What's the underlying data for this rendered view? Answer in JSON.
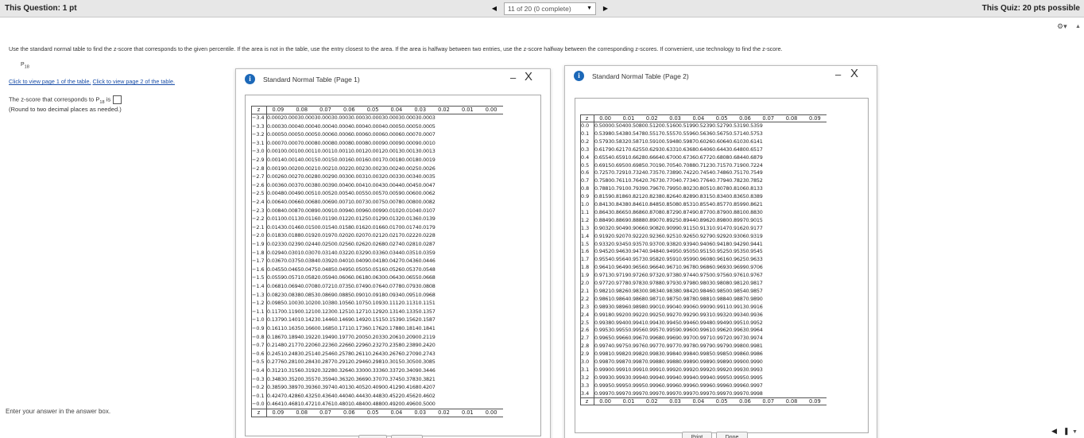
{
  "header": {
    "question_label": "This Question: 1 pt",
    "quiz_label": "This Quiz: 20 pts possible",
    "progress": "11 of 20 (0 complete)",
    "prev_icon": "triangle-left-icon",
    "next_icon": "triangle-right-icon",
    "dropdown_icon": "caret-down-icon"
  },
  "question": {
    "instructions": "Use the standard normal table to find the z-score that corresponds to the given percentile. If the area is not in the table, use the entry closest to the area. If the area is halfway between two entries, use the z-score halfway between the corresponding z-scores. If convenient, use technology to find the z-score.",
    "percentile_base": "P",
    "percentile_sub": "18",
    "link1": "Click to view page 1 of the table.",
    "link2": "Click to view page 2 of the table.",
    "answer_prefix": "The z-score that corresponds to P",
    "answer_sub": "18",
    "answer_suffix": " is",
    "round_note": "(Round to two decimal places as needed.)",
    "enter_message": "Enter your answer in the answer box."
  },
  "dialog1": {
    "title": "Standard Normal Table (Page 1)",
    "min_label": "–",
    "close_label": "X",
    "columns": [
      "z",
      "0.09",
      "0.08",
      "0.07",
      "0.06",
      "0.05",
      "0.04",
      "0.03",
      "0.02",
      "0.01",
      "0.00"
    ],
    "rows": [
      [
        "−3.4",
        "0.0002",
        "0.0003",
        "0.0003",
        "0.0003",
        "0.0003",
        "0.0003",
        "0.0003",
        "0.0003",
        "0.0003",
        "0.0003"
      ],
      [
        "−3.3",
        "0.0003",
        "0.0004",
        "0.0004",
        "0.0004",
        "0.0004",
        "0.0004",
        "0.0004",
        "0.0005",
        "0.0005",
        "0.0005"
      ],
      [
        "−3.2",
        "0.0005",
        "0.0005",
        "0.0005",
        "0.0006",
        "0.0006",
        "0.0006",
        "0.0006",
        "0.0006",
        "0.0007",
        "0.0007"
      ],
      [
        "−3.1",
        "0.0007",
        "0.0007",
        "0.0008",
        "0.0008",
        "0.0008",
        "0.0008",
        "0.0009",
        "0.0009",
        "0.0009",
        "0.0010"
      ],
      [
        "−3.0",
        "0.0010",
        "0.0010",
        "0.0011",
        "0.0011",
        "0.0011",
        "0.0012",
        "0.0012",
        "0.0013",
        "0.0013",
        "0.0013"
      ],
      [
        "−2.9",
        "0.0014",
        "0.0014",
        "0.0015",
        "0.0015",
        "0.0016",
        "0.0016",
        "0.0017",
        "0.0018",
        "0.0018",
        "0.0019"
      ],
      [
        "−2.8",
        "0.0019",
        "0.0020",
        "0.0021",
        "0.0021",
        "0.0022",
        "0.0023",
        "0.0023",
        "0.0024",
        "0.0025",
        "0.0026"
      ],
      [
        "−2.7",
        "0.0026",
        "0.0027",
        "0.0028",
        "0.0029",
        "0.0030",
        "0.0031",
        "0.0032",
        "0.0033",
        "0.0034",
        "0.0035"
      ],
      [
        "−2.6",
        "0.0036",
        "0.0037",
        "0.0038",
        "0.0039",
        "0.0040",
        "0.0041",
        "0.0043",
        "0.0044",
        "0.0045",
        "0.0047"
      ],
      [
        "−2.5",
        "0.0048",
        "0.0049",
        "0.0051",
        "0.0052",
        "0.0054",
        "0.0055",
        "0.0057",
        "0.0059",
        "0.0060",
        "0.0062"
      ],
      [
        "−2.4",
        "0.0064",
        "0.0066",
        "0.0068",
        "0.0069",
        "0.0071",
        "0.0073",
        "0.0075",
        "0.0078",
        "0.0080",
        "0.0082"
      ],
      [
        "−2.3",
        "0.0084",
        "0.0087",
        "0.0089",
        "0.0091",
        "0.0094",
        "0.0096",
        "0.0099",
        "0.0102",
        "0.0104",
        "0.0107"
      ],
      [
        "−2.2",
        "0.0110",
        "0.0113",
        "0.0116",
        "0.0119",
        "0.0122",
        "0.0125",
        "0.0129",
        "0.0132",
        "0.0136",
        "0.0139"
      ],
      [
        "−2.1",
        "0.0143",
        "0.0146",
        "0.0150",
        "0.0154",
        "0.0158",
        "0.0162",
        "0.0166",
        "0.0170",
        "0.0174",
        "0.0179"
      ],
      [
        "−2.0",
        "0.0183",
        "0.0188",
        "0.0192",
        "0.0197",
        "0.0202",
        "0.0207",
        "0.0212",
        "0.0217",
        "0.0222",
        "0.0228"
      ],
      [
        "−1.9",
        "0.0233",
        "0.0239",
        "0.0244",
        "0.0250",
        "0.0256",
        "0.0262",
        "0.0268",
        "0.0274",
        "0.0281",
        "0.0287"
      ],
      [
        "−1.8",
        "0.0294",
        "0.0301",
        "0.0307",
        "0.0314",
        "0.0322",
        "0.0329",
        "0.0336",
        "0.0344",
        "0.0351",
        "0.0359"
      ],
      [
        "−1.7",
        "0.0367",
        "0.0375",
        "0.0384",
        "0.0392",
        "0.0401",
        "0.0409",
        "0.0418",
        "0.0427",
        "0.0436",
        "0.0446"
      ],
      [
        "−1.6",
        "0.0455",
        "0.0465",
        "0.0475",
        "0.0485",
        "0.0495",
        "0.0505",
        "0.0516",
        "0.0526",
        "0.0537",
        "0.0548"
      ],
      [
        "−1.5",
        "0.0559",
        "0.0571",
        "0.0582",
        "0.0594",
        "0.0606",
        "0.0618",
        "0.0630",
        "0.0643",
        "0.0655",
        "0.0668"
      ],
      [
        "−1.4",
        "0.0681",
        "0.0694",
        "0.0708",
        "0.0721",
        "0.0735",
        "0.0749",
        "0.0764",
        "0.0778",
        "0.0793",
        "0.0808"
      ],
      [
        "−1.3",
        "0.0823",
        "0.0838",
        "0.0853",
        "0.0869",
        "0.0885",
        "0.0901",
        "0.0918",
        "0.0934",
        "0.0951",
        "0.0968"
      ],
      [
        "−1.2",
        "0.0985",
        "0.1003",
        "0.1020",
        "0.1038",
        "0.1056",
        "0.1075",
        "0.1093",
        "0.1112",
        "0.1131",
        "0.1151"
      ],
      [
        "−1.1",
        "0.1170",
        "0.1190",
        "0.1210",
        "0.1230",
        "0.1251",
        "0.1271",
        "0.1292",
        "0.1314",
        "0.1335",
        "0.1357"
      ],
      [
        "−1.0",
        "0.1379",
        "0.1401",
        "0.1423",
        "0.1446",
        "0.1469",
        "0.1492",
        "0.1515",
        "0.1539",
        "0.1562",
        "0.1587"
      ],
      [
        "−0.9",
        "0.1611",
        "0.1635",
        "0.1660",
        "0.1685",
        "0.1711",
        "0.1736",
        "0.1762",
        "0.1788",
        "0.1814",
        "0.1841"
      ],
      [
        "−0.8",
        "0.1867",
        "0.1894",
        "0.1922",
        "0.1949",
        "0.1977",
        "0.2005",
        "0.2033",
        "0.2061",
        "0.2090",
        "0.2119"
      ],
      [
        "−0.7",
        "0.2148",
        "0.2177",
        "0.2206",
        "0.2236",
        "0.2266",
        "0.2296",
        "0.2327",
        "0.2358",
        "0.2389",
        "0.2420"
      ],
      [
        "−0.6",
        "0.2451",
        "0.2483",
        "0.2514",
        "0.2546",
        "0.2578",
        "0.2611",
        "0.2643",
        "0.2676",
        "0.2709",
        "0.2743"
      ],
      [
        "−0.5",
        "0.2776",
        "0.2810",
        "0.2843",
        "0.2877",
        "0.2912",
        "0.2946",
        "0.2981",
        "0.3015",
        "0.3050",
        "0.3085"
      ],
      [
        "−0.4",
        "0.3121",
        "0.3156",
        "0.3192",
        "0.3228",
        "0.3264",
        "0.3300",
        "0.3336",
        "0.3372",
        "0.3409",
        "0.3446"
      ],
      [
        "−0.3",
        "0.3483",
        "0.3520",
        "0.3557",
        "0.3594",
        "0.3632",
        "0.3669",
        "0.3707",
        "0.3745",
        "0.3783",
        "0.3821"
      ],
      [
        "−0.2",
        "0.3859",
        "0.3897",
        "0.3936",
        "0.3974",
        "0.4013",
        "0.4052",
        "0.4090",
        "0.4129",
        "0.4168",
        "0.4207"
      ],
      [
        "−0.1",
        "0.4247",
        "0.4286",
        "0.4325",
        "0.4364",
        "0.4404",
        "0.4443",
        "0.4483",
        "0.4522",
        "0.4562",
        "0.4602"
      ],
      [
        "−0.0",
        "0.4641",
        "0.4681",
        "0.4721",
        "0.4761",
        "0.4801",
        "0.4840",
        "0.4880",
        "0.4920",
        "0.4960",
        "0.5000"
      ]
    ]
  },
  "dialog2": {
    "title": "Standard Normal Table (Page 2)",
    "min_label": "–",
    "close_label": "X",
    "columns": [
      "z",
      "0.00",
      "0.01",
      "0.02",
      "0.03",
      "0.04",
      "0.05",
      "0.06",
      "0.07",
      "0.08",
      "0.09"
    ],
    "rows": [
      [
        "0.0",
        "0.5000",
        "0.5040",
        "0.5080",
        "0.5120",
        "0.5160",
        "0.5199",
        "0.5239",
        "0.5279",
        "0.5319",
        "0.5359"
      ],
      [
        "0.1",
        "0.5398",
        "0.5438",
        "0.5478",
        "0.5517",
        "0.5557",
        "0.5596",
        "0.5636",
        "0.5675",
        "0.5714",
        "0.5753"
      ],
      [
        "0.2",
        "0.5793",
        "0.5832",
        "0.5871",
        "0.5910",
        "0.5948",
        "0.5987",
        "0.6026",
        "0.6064",
        "0.6103",
        "0.6141"
      ],
      [
        "0.3",
        "0.6179",
        "0.6217",
        "0.6255",
        "0.6293",
        "0.6331",
        "0.6368",
        "0.6406",
        "0.6443",
        "0.6480",
        "0.6517"
      ],
      [
        "0.4",
        "0.6554",
        "0.6591",
        "0.6628",
        "0.6664",
        "0.6700",
        "0.6736",
        "0.6772",
        "0.6808",
        "0.6844",
        "0.6879"
      ],
      [
        "0.5",
        "0.6915",
        "0.6950",
        "0.6985",
        "0.7019",
        "0.7054",
        "0.7088",
        "0.7123",
        "0.7157",
        "0.7190",
        "0.7224"
      ],
      [
        "0.6",
        "0.7257",
        "0.7291",
        "0.7324",
        "0.7357",
        "0.7389",
        "0.7422",
        "0.7454",
        "0.7486",
        "0.7517",
        "0.7549"
      ],
      [
        "0.7",
        "0.7580",
        "0.7611",
        "0.7642",
        "0.7673",
        "0.7704",
        "0.7734",
        "0.7764",
        "0.7794",
        "0.7823",
        "0.7852"
      ],
      [
        "0.8",
        "0.7881",
        "0.7910",
        "0.7939",
        "0.7967",
        "0.7995",
        "0.8023",
        "0.8051",
        "0.8078",
        "0.8106",
        "0.8133"
      ],
      [
        "0.9",
        "0.8159",
        "0.8186",
        "0.8212",
        "0.8238",
        "0.8264",
        "0.8289",
        "0.8315",
        "0.8340",
        "0.8365",
        "0.8389"
      ],
      [
        "1.0",
        "0.8413",
        "0.8438",
        "0.8461",
        "0.8485",
        "0.8508",
        "0.8531",
        "0.8554",
        "0.8577",
        "0.8599",
        "0.8621"
      ],
      [
        "1.1",
        "0.8643",
        "0.8665",
        "0.8686",
        "0.8708",
        "0.8729",
        "0.8749",
        "0.8770",
        "0.8790",
        "0.8810",
        "0.8830"
      ],
      [
        "1.2",
        "0.8849",
        "0.8869",
        "0.8888",
        "0.8907",
        "0.8925",
        "0.8944",
        "0.8962",
        "0.8980",
        "0.8997",
        "0.9015"
      ],
      [
        "1.3",
        "0.9032",
        "0.9049",
        "0.9066",
        "0.9082",
        "0.9099",
        "0.9115",
        "0.9131",
        "0.9147",
        "0.9162",
        "0.9177"
      ],
      [
        "1.4",
        "0.9192",
        "0.9207",
        "0.9222",
        "0.9236",
        "0.9251",
        "0.9265",
        "0.9279",
        "0.9292",
        "0.9306",
        "0.9319"
      ],
      [
        "1.5",
        "0.9332",
        "0.9345",
        "0.9357",
        "0.9370",
        "0.9382",
        "0.9394",
        "0.9406",
        "0.9418",
        "0.9429",
        "0.9441"
      ],
      [
        "1.6",
        "0.9452",
        "0.9463",
        "0.9474",
        "0.9484",
        "0.9495",
        "0.9505",
        "0.9515",
        "0.9525",
        "0.9535",
        "0.9545"
      ],
      [
        "1.7",
        "0.9554",
        "0.9564",
        "0.9573",
        "0.9582",
        "0.9591",
        "0.9599",
        "0.9608",
        "0.9616",
        "0.9625",
        "0.9633"
      ],
      [
        "1.8",
        "0.9641",
        "0.9649",
        "0.9656",
        "0.9664",
        "0.9671",
        "0.9678",
        "0.9686",
        "0.9693",
        "0.9699",
        "0.9706"
      ],
      [
        "1.9",
        "0.9713",
        "0.9719",
        "0.9726",
        "0.9732",
        "0.9738",
        "0.9744",
        "0.9750",
        "0.9756",
        "0.9761",
        "0.9767"
      ],
      [
        "2.0",
        "0.9772",
        "0.9778",
        "0.9783",
        "0.9788",
        "0.9793",
        "0.9798",
        "0.9803",
        "0.9808",
        "0.9812",
        "0.9817"
      ],
      [
        "2.1",
        "0.9821",
        "0.9826",
        "0.9830",
        "0.9834",
        "0.9838",
        "0.9842",
        "0.9846",
        "0.9850",
        "0.9854",
        "0.9857"
      ],
      [
        "2.2",
        "0.9861",
        "0.9864",
        "0.9868",
        "0.9871",
        "0.9875",
        "0.9878",
        "0.9881",
        "0.9884",
        "0.9887",
        "0.9890"
      ],
      [
        "2.3",
        "0.9893",
        "0.9896",
        "0.9898",
        "0.9901",
        "0.9904",
        "0.9906",
        "0.9909",
        "0.9911",
        "0.9913",
        "0.9916"
      ],
      [
        "2.4",
        "0.9918",
        "0.9920",
        "0.9922",
        "0.9925",
        "0.9927",
        "0.9929",
        "0.9931",
        "0.9932",
        "0.9934",
        "0.9936"
      ],
      [
        "2.5",
        "0.9938",
        "0.9940",
        "0.9941",
        "0.9943",
        "0.9945",
        "0.9946",
        "0.9948",
        "0.9949",
        "0.9951",
        "0.9952"
      ],
      [
        "2.6",
        "0.9953",
        "0.9955",
        "0.9956",
        "0.9957",
        "0.9959",
        "0.9960",
        "0.9961",
        "0.9962",
        "0.9963",
        "0.9964"
      ],
      [
        "2.7",
        "0.9965",
        "0.9966",
        "0.9967",
        "0.9968",
        "0.9969",
        "0.9970",
        "0.9971",
        "0.9972",
        "0.9973",
        "0.9974"
      ],
      [
        "2.8",
        "0.9974",
        "0.9975",
        "0.9976",
        "0.9977",
        "0.9977",
        "0.9978",
        "0.9979",
        "0.9979",
        "0.9980",
        "0.9981"
      ],
      [
        "2.9",
        "0.9981",
        "0.9982",
        "0.9982",
        "0.9983",
        "0.9984",
        "0.9984",
        "0.9985",
        "0.9985",
        "0.9986",
        "0.9986"
      ],
      [
        "3.0",
        "0.9987",
        "0.9987",
        "0.9987",
        "0.9988",
        "0.9988",
        "0.9989",
        "0.9989",
        "0.9989",
        "0.9990",
        "0.9990"
      ],
      [
        "3.1",
        "0.9990",
        "0.9991",
        "0.9991",
        "0.9991",
        "0.9992",
        "0.9992",
        "0.9992",
        "0.9992",
        "0.9993",
        "0.9993"
      ],
      [
        "3.2",
        "0.9993",
        "0.9993",
        "0.9994",
        "0.9994",
        "0.9994",
        "0.9994",
        "0.9994",
        "0.9995",
        "0.9995",
        "0.9995"
      ],
      [
        "3.3",
        "0.9995",
        "0.9995",
        "0.9995",
        "0.9996",
        "0.9996",
        "0.9996",
        "0.9996",
        "0.9996",
        "0.9996",
        "0.9997"
      ],
      [
        "3.4",
        "0.9997",
        "0.9997",
        "0.9997",
        "0.9997",
        "0.9997",
        "0.9997",
        "0.9997",
        "0.9997",
        "0.9997",
        "0.9998"
      ]
    ],
    "print_label": "Print",
    "done_label": "Done"
  }
}
